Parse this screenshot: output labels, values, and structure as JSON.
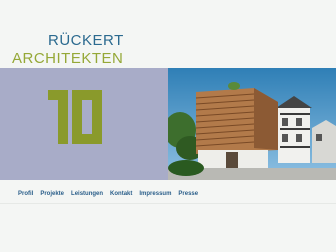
{
  "header": {
    "name_line1": "RÜCKERT",
    "name_line2": "ARCHITEKTEN"
  },
  "colors": {
    "background": "#f4f6f4",
    "band": "#a8acc8",
    "logo_green": "#8a9a2b",
    "title_blue": "#2b6a8f",
    "title_green": "#95a837",
    "nav_blue": "#2b5f8a"
  },
  "logo": {
    "icon": "ra-monogram-logo"
  },
  "photo": {
    "subject": "wooden-slatted-house-photo"
  },
  "nav": {
    "items": [
      {
        "label": "Profil"
      },
      {
        "label": "Projekte"
      },
      {
        "label": "Leistungen"
      },
      {
        "label": "Kontakt"
      },
      {
        "label": "Impressum"
      },
      {
        "label": "Presse"
      }
    ]
  }
}
